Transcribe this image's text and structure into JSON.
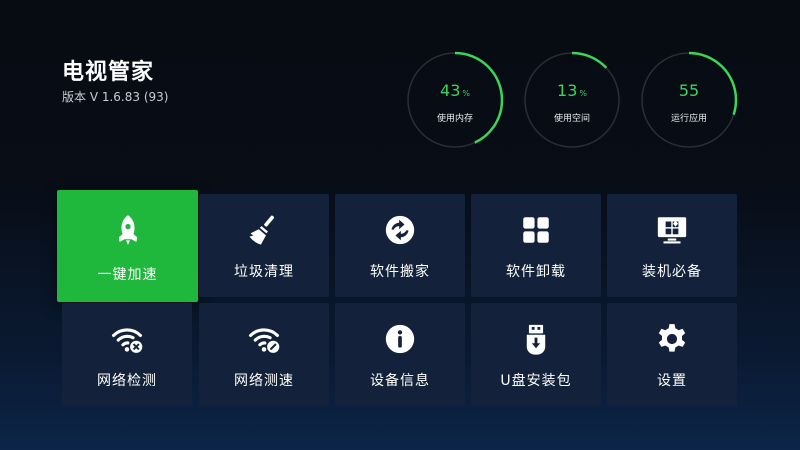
{
  "app": {
    "title": "电视管家",
    "version": "版本 V 1.6.83 (93)"
  },
  "stats": [
    {
      "value": "43",
      "unit": "%",
      "label": "使用内存",
      "percent": 43
    },
    {
      "value": "13",
      "unit": "%",
      "label": "使用空间",
      "percent": 13
    },
    {
      "value": "55",
      "unit": "",
      "label": "运行应用",
      "percent": 30
    }
  ],
  "tiles": [
    {
      "label": "一键加速",
      "icon": "rocket-icon",
      "selected": true
    },
    {
      "label": "垃圾清理",
      "icon": "broom-icon"
    },
    {
      "label": "软件搬家",
      "icon": "move-icon"
    },
    {
      "label": "软件卸载",
      "icon": "apps-grid-icon"
    },
    {
      "label": "装机必备",
      "icon": "monitor-install-icon"
    },
    {
      "label": "网络检测",
      "icon": "wifi-check-icon"
    },
    {
      "label": "网络测速",
      "icon": "wifi-speed-icon"
    },
    {
      "label": "设备信息",
      "icon": "info-icon"
    },
    {
      "label": "U盘安装包",
      "icon": "usb-icon"
    },
    {
      "label": "设置",
      "icon": "gear-icon"
    }
  ],
  "colors": {
    "accent": "#1fb83c",
    "gauge": "#3bd55a",
    "tile": "#13223a"
  }
}
